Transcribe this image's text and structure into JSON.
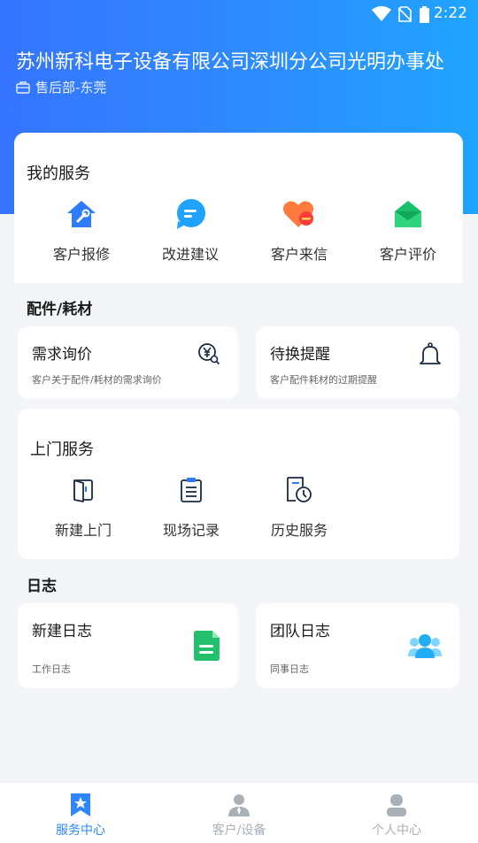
{
  "status": {
    "time": "2:22"
  },
  "header": {
    "company": "苏州新科电子设备有限公司深圳分公司光明办事处",
    "department": "售后部-东莞"
  },
  "my_services": {
    "title": "我的服务",
    "items": [
      {
        "label": "客户报修",
        "icon": "house-wrench-icon"
      },
      {
        "label": "改进建议",
        "icon": "chat-bubble-icon"
      },
      {
        "label": "客户来信",
        "icon": "heart-mail-icon"
      },
      {
        "label": "客户评价",
        "icon": "envelope-open-icon"
      }
    ]
  },
  "parts": {
    "title": "配件/耗材",
    "cards": [
      {
        "title": "需求询价",
        "subtitle": "客户关于配件/耗材的需求询价",
        "icon": "yen-search-icon"
      },
      {
        "title": "待换提醒",
        "subtitle": "客户配件耗材的过期提醒",
        "icon": "bell-icon"
      }
    ]
  },
  "onsite": {
    "title": "上门服务",
    "items": [
      {
        "label": "新建上门",
        "icon": "door-icon"
      },
      {
        "label": "现场记录",
        "icon": "clipboard-icon"
      },
      {
        "label": "历史服务",
        "icon": "history-doc-icon"
      }
    ]
  },
  "log": {
    "title": "日志",
    "cards": [
      {
        "title": "新建日志",
        "subtitle": "工作日志",
        "icon": "green-doc-icon"
      },
      {
        "title": "团队日志",
        "subtitle": "同事日志",
        "icon": "team-icon"
      }
    ]
  },
  "tabbar": {
    "items": [
      {
        "label": "服务中心",
        "active": true,
        "icon": "star-bookmark-icon"
      },
      {
        "label": "客户/设备",
        "active": false,
        "icon": "person-icon"
      },
      {
        "label": "个人中心",
        "active": false,
        "icon": "user-icon"
      }
    ]
  },
  "colors": {
    "primary": "#2e86ff",
    "inactive": "#aab0b8",
    "background": "#f3f5f8"
  }
}
